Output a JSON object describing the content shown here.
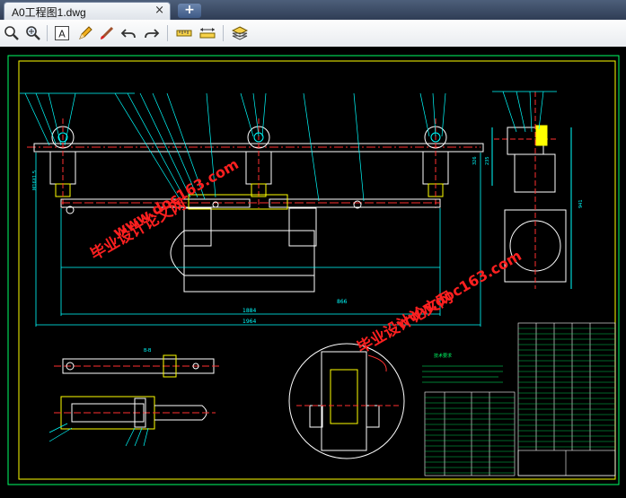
{
  "tab": {
    "title": "A0工程图1.dwg",
    "close_glyph": "×",
    "add_glyph": "+"
  },
  "toolbar": {
    "buttons": [
      {
        "name": "zoom-icon"
      },
      {
        "name": "zoom-window-icon"
      },
      {
        "name": "text-icon"
      },
      {
        "name": "pencil-icon"
      },
      {
        "name": "brush-icon"
      },
      {
        "name": "undo-icon"
      },
      {
        "name": "redo-icon"
      },
      {
        "name": "measure-icon"
      },
      {
        "name": "dimension-icon"
      },
      {
        "name": "layers-icon"
      }
    ],
    "text_glyph": "A"
  },
  "drawing": {
    "dim_total": "1964",
    "dim_middle": "1884",
    "dim_right": "866",
    "side_dim_a": "326",
    "side_dim_b": "235",
    "side_dim_c": "941",
    "left_dim": "M16X1.5",
    "section_label": "B-B",
    "tech_title": "技术要求",
    "watermark_cn": "毕业设计论文网",
    "watermark_url": "www.doc163.com"
  },
  "colors": {
    "line_main": "#ffffff",
    "line_green": "#00ff66",
    "line_yellow": "#ffff00",
    "line_cyan": "#00ffff",
    "line_red": "#ff3030",
    "watermark": "#ff2020"
  }
}
